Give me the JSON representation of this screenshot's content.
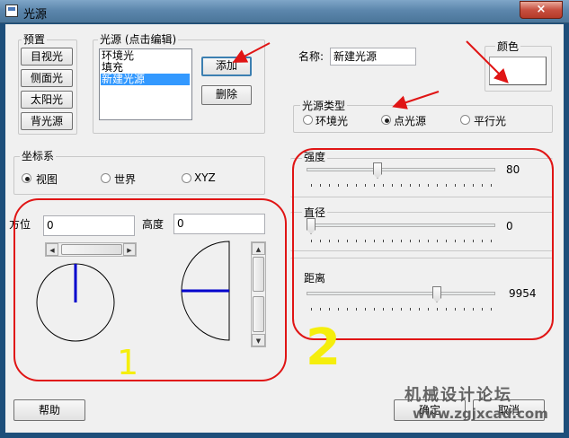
{
  "window": {
    "title": "光源",
    "close_glyph": "×"
  },
  "preset": {
    "label": "预置",
    "buttons": [
      "目视光",
      "侧面光",
      "太阳光",
      "背光源"
    ]
  },
  "lights": {
    "label": "光源 (点击编辑)",
    "items": [
      "环境光",
      "填充",
      "新建光源"
    ],
    "selected_index": 2,
    "add_label": "添加",
    "delete_label": "删除"
  },
  "name": {
    "label": "名称:",
    "value": "新建光源"
  },
  "color": {
    "label": "颜色",
    "swatch": "#ffffff"
  },
  "light_type": {
    "label": "光源类型",
    "options": [
      "环境光",
      "点光源",
      "平行光"
    ],
    "selected_index": 1
  },
  "coords": {
    "label": "坐标系",
    "options": [
      "视图",
      "世界",
      "XYZ"
    ],
    "selected_index": 0
  },
  "orientation": {
    "azimuth_label": "方位",
    "azimuth_value": "0",
    "height_label": "高度",
    "height_value": "0"
  },
  "sliders": [
    {
      "label": "强度",
      "value": "80",
      "fraction": 0.37
    },
    {
      "label": "直径",
      "value": "0",
      "fraction": 0.0
    },
    {
      "label": "距离",
      "value": "9954",
      "fraction": 0.7
    }
  ],
  "footer": {
    "help_label": "帮助",
    "ok_label": "确定",
    "cancel_label": "取消"
  },
  "annotations": {
    "mark1": "1",
    "mark2": "2"
  },
  "watermark": {
    "text": "机械设计论坛",
    "url": "www.zgjxcad.com"
  },
  "colors": {
    "annotation_red": "#e01515",
    "annotation_yellow": "#f5ee0c",
    "indicator_blue": "#0000cc",
    "selection": "#3399ff"
  }
}
